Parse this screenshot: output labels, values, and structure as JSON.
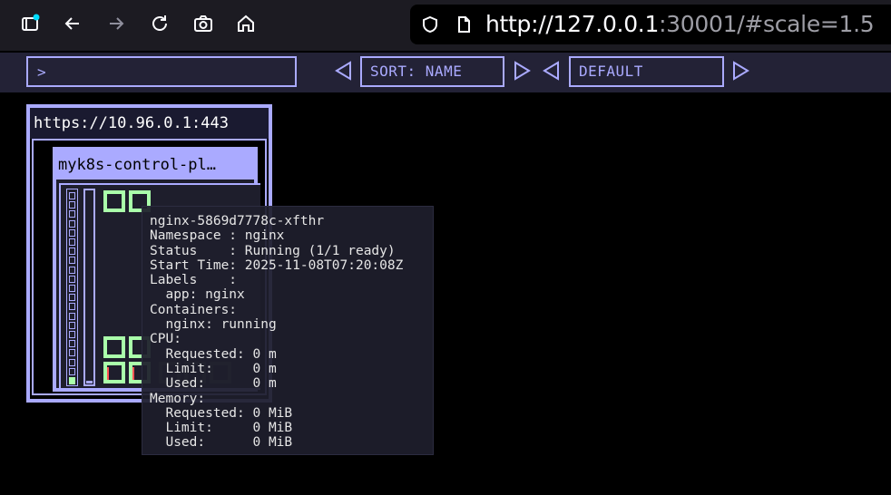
{
  "browser": {
    "url_host": "http://127.0.0.1",
    "url_rest": ":30001/#scale=1.5",
    "icons": [
      "sidebar-icon",
      "back-icon",
      "forward-icon",
      "reload-icon",
      "screenshot-icon",
      "home-icon",
      "shield-icon",
      "page-icon"
    ]
  },
  "toolbar": {
    "filter_value": ">",
    "sort_label": "SORT: NAME",
    "theme_label": "DEFAULT"
  },
  "cluster": {
    "title": "https://10.96.0.1:443",
    "node_title": "myk8s-control-pl…"
  },
  "tooltip": {
    "lines": [
      "nginx-5869d7778c-xfthr",
      "Namespace : nginx",
      "Status    : Running (1/1 ready)",
      "Start Time: 2025-11-08T07:20:08Z",
      "Labels    :",
      "  app: nginx",
      "Containers:",
      "  nginx: running",
      "CPU:",
      "  Requested: 0 m",
      "  Limit:     0 m",
      "  Used:      0 m",
      "Memory:",
      "  Requested: 0 MiB",
      "  Limit:     0 MiB",
      "  Used:      0 MiB"
    ]
  },
  "colors": {
    "accent": "#aaaaff",
    "pod": "#aaffaa",
    "background": "#000000"
  }
}
